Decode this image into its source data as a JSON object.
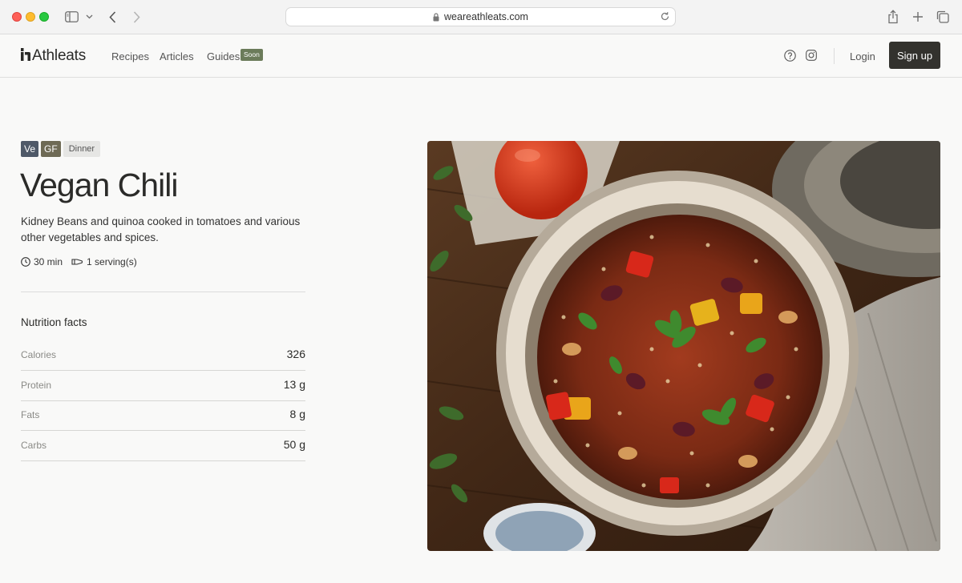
{
  "browser": {
    "url": "weareathleats.com",
    "icons": [
      "sidebar-icon",
      "chevron-down-icon",
      "back-icon",
      "forward-icon",
      "lock-icon",
      "reload-icon",
      "share-icon",
      "new-tab-icon",
      "tabs-overview-icon"
    ]
  },
  "nav": {
    "brand": "Athleats",
    "links": [
      "Recipes",
      "Articles",
      "Guides"
    ],
    "soon_badge": "Soon",
    "login": "Login",
    "signup": "Sign up"
  },
  "recipe": {
    "tags": [
      "Ve",
      "GF",
      "Dinner"
    ],
    "title": "Vegan Chili",
    "description": "Kidney Beans and quinoa cooked in tomatoes and various other vegetables and spices.",
    "time": "30 min",
    "servings": "1 serving(s)"
  },
  "nutrition": {
    "title": "Nutrition facts",
    "rows": [
      {
        "label": "Calories",
        "value": "326"
      },
      {
        "label": "Protein",
        "value": "13 g"
      },
      {
        "label": "Fats",
        "value": "8 g"
      },
      {
        "label": "Carbs",
        "value": "50 g"
      }
    ]
  },
  "colors": {
    "tag_ve": "#4f5968",
    "tag_gf": "#6e6a55",
    "soon": "#6b7b5a",
    "signup_bg": "#33322e"
  }
}
